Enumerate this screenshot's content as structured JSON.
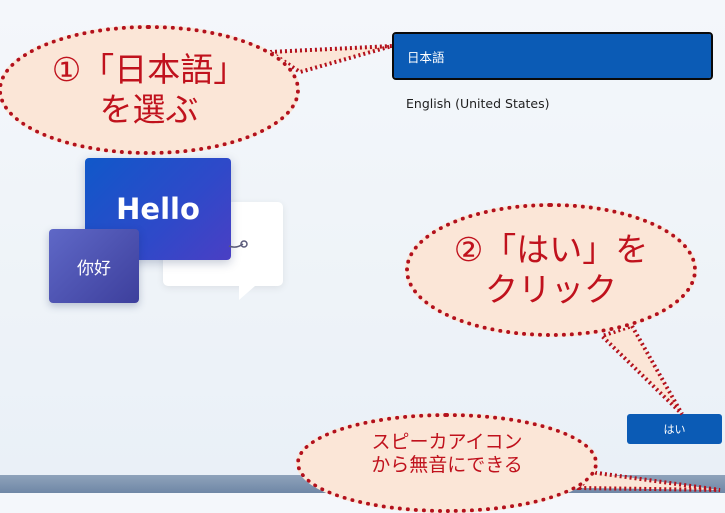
{
  "language_list": {
    "items": [
      {
        "label": "日本語",
        "selected": true
      },
      {
        "label": "English (United States)",
        "selected": false
      }
    ]
  },
  "illustration": {
    "hello_text": "Hello",
    "nihao_text": "你好"
  },
  "buttons": {
    "yes_label": "はい"
  },
  "annotations": {
    "step1_line1": "①「日本語」",
    "step1_line2": "を選ぶ",
    "step2_line1": "②「はい」を",
    "step2_line2": "クリック",
    "note_line1": "スピーカアイコン",
    "note_line2": "から無音にできる"
  },
  "colors": {
    "accent": "#0b5bb5",
    "callout_fill": "#fbe6d7",
    "callout_border": "#b3111c"
  }
}
